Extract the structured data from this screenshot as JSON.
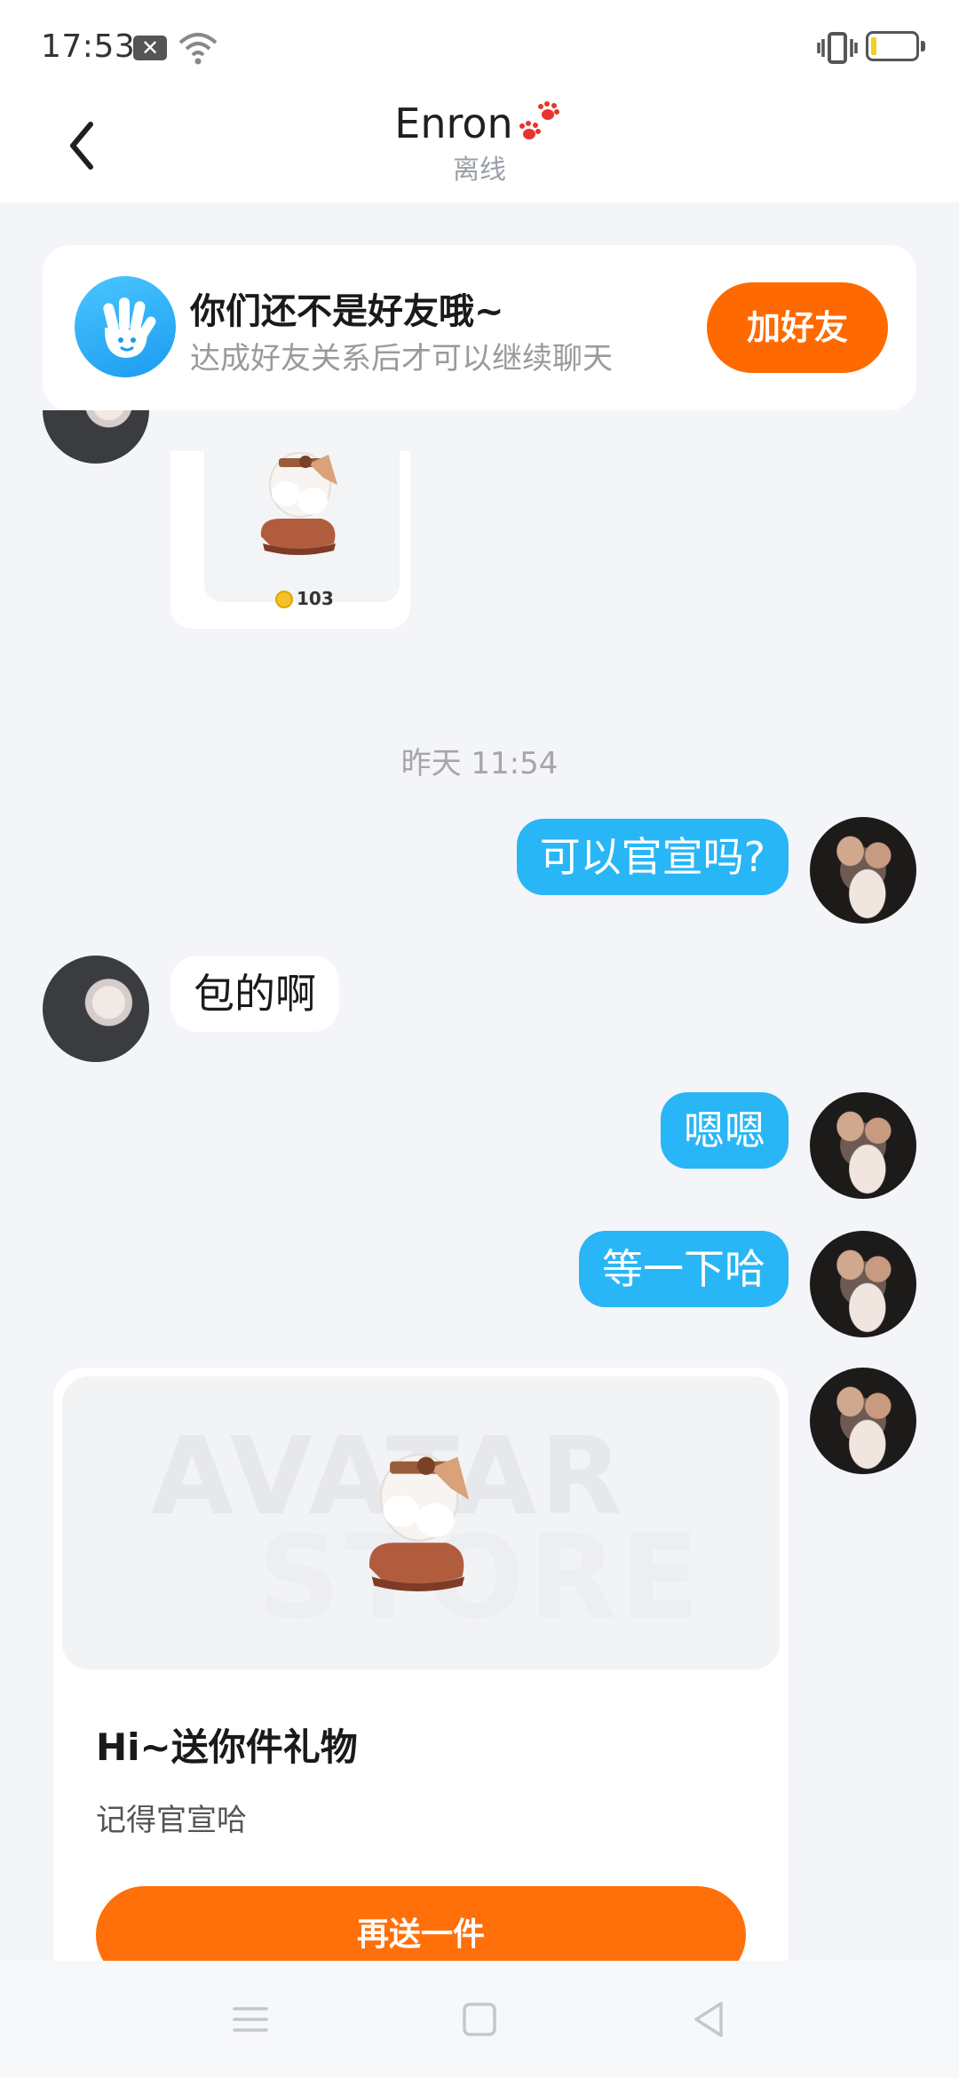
{
  "status_bar": {
    "time": "17:53"
  },
  "header": {
    "title": "Enron",
    "subtitle": "离线"
  },
  "banner": {
    "title": "你们还不是好友哦~",
    "subtitle": "达成好友关系后才可以继续聊天",
    "button_label": "加好友"
  },
  "chat": {
    "gift_thumb_price": "103",
    "timestamp": "昨天 11:54",
    "messages": [
      {
        "from": "self",
        "text": "可以官宣吗?"
      },
      {
        "from": "other",
        "text": "包的啊"
      },
      {
        "from": "self",
        "text": "嗯嗯"
      },
      {
        "from": "self",
        "text": "等一下哈"
      }
    ],
    "gift_card": {
      "watermark_line1": "AVATAR",
      "watermark_line2": "STORE",
      "title": "Hi~送你件礼物",
      "subtitle": "记得官宣哈",
      "button_label": "再送一件"
    }
  },
  "colors": {
    "accent_orange": "#ff6a00",
    "bubble_blue": "#29b6f6",
    "background": "#f3f5f8"
  },
  "icons": [
    "back-icon",
    "paw-icon",
    "wave-hand-icon",
    "coin-icon",
    "menu-icon",
    "home-icon",
    "nav-back-icon",
    "wifi-icon",
    "vibrate-icon",
    "battery-icon"
  ]
}
